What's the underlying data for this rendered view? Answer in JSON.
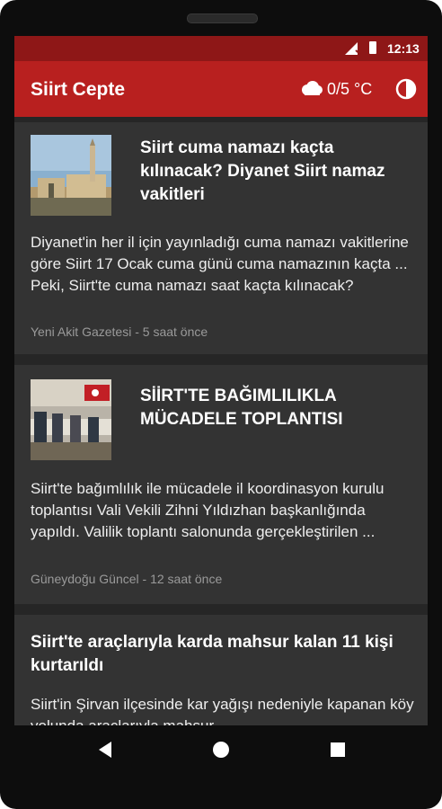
{
  "status_bar": {
    "time": "12:13"
  },
  "app_bar": {
    "title": "Siirt Cepte",
    "weather": "0/5 °C"
  },
  "articles": [
    {
      "title": "Siirt cuma namazı kaçta kılınacak? Diyanet Siirt namaz vakitleri",
      "summary": "Diyanet'in her il için yayınladığı cuma namazı vakitlerine göre Siirt 17 Ocak cuma günü cuma namazının kaçta ... Peki, Siirt'te cuma namazı saat kaçta kılınacak?",
      "meta": "Yeni Akit Gazetesi - 5 saat önce"
    },
    {
      "title": "SİİRT'TE BAĞIMLILIKLA MÜCADELE TOPLANTISI",
      "summary": "Siirt'te bağımlılık ile mücadele il koordinasyon kurulu toplantısı Vali Vekili Zihni Yıldızhan başkanlığında yapıldı. Valilik toplantı salonunda gerçekleştirilen ...",
      "meta": "Güneydoğu Güncel - 12 saat önce"
    },
    {
      "title": "Siirt'te araçlarıyla karda mahsur kalan 11 kişi kurtarıldı",
      "summary": "Siirt'in Şirvan ilçesinde kar yağışı nedeniyle kapanan köy yolunda araçlarıyla mahsur"
    }
  ]
}
